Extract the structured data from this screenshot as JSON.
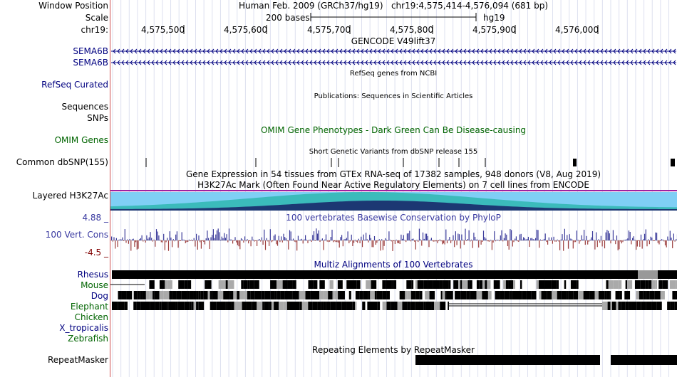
{
  "header": {
    "window_position_label": "Window Position",
    "assembly": "Human Feb. 2009 (GRCh37/hg19)",
    "position": "chr19:4,575,414-4,576,094 (681 bp)",
    "scale_label": "Scale",
    "scale_bar_text": "200 bases",
    "scale_db": "hg19",
    "chrom_label": "chr19:",
    "ruler_ticks": [
      "4,575,500",
      "4,575,600",
      "4,575,700",
      "4,575,800",
      "4,575,900",
      "4,576,000"
    ]
  },
  "tracks": {
    "gencode_title": "GENCODE V49lift37",
    "gene1": "SEMA6B",
    "gene2": "SEMA6B",
    "refseq_title": "RefSeq genes from NCBI",
    "refseq_label": "RefSeq Curated",
    "pubs_title": "Publications: Sequences in Scientific Articles",
    "sequences_label": "Sequences",
    "snps_label": "SNPs",
    "omim_title": "OMIM Gene Phenotypes - Dark Green Can Be Disease-causing",
    "omim_label": "OMIM Genes",
    "dbsnp_title": "Short Genetic Variants from dbSNP release 155",
    "dbsnp_label": "Common dbSNP(155)",
    "gtex_title": "Gene Expression in 54 tissues from GTEx RNA-seq of 17382 samples, 948 donors (V8, Aug 2019)",
    "h3k27_title": "H3K27Ac Mark (Often Found Near Active Regulatory Elements) on 7 cell lines from ENCODE",
    "h3k27_label": "Layered H3K27Ac",
    "cons_max": "4.88 _",
    "cons_title": "100 vertebrates Basewise Conservation by PhyloP",
    "cons_label": "100 Vert. Cons",
    "cons_min": "-4.5 _",
    "multiz_title": "Multiz Alignments of 100 Vertebrates",
    "species": [
      "Rhesus",
      "Mouse",
      "Dog",
      "Elephant",
      "Chicken",
      "X_tropicalis",
      "Zebrafish"
    ],
    "repeat_title": "Repeating Elements by RepeatMasker",
    "repeat_label": "RepeatMasker"
  },
  "colors": {
    "navy": "#000080",
    "green": "#006400",
    "cons_pos": "#3b3b9b",
    "cons_neg": "#9b3b3b",
    "h3k_light": "#7fcff5",
    "h3k_teal": "#2fb7b0",
    "h3k_dark": "#1a2a6c",
    "h3k_purple": "#a020a0"
  }
}
